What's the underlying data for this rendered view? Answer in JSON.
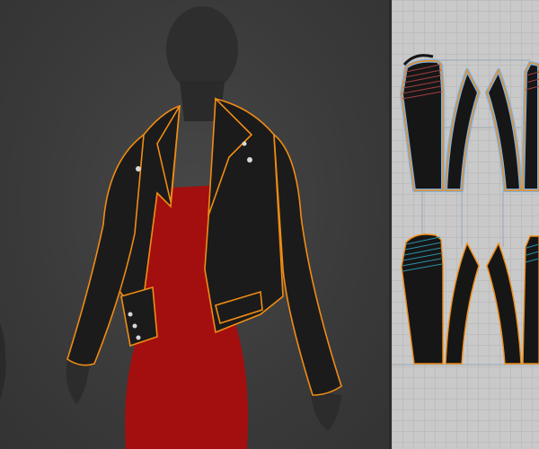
{
  "viewport_3d": {
    "background": "#3a3a3a",
    "avatar_color": "#2c2c2c",
    "dress_color": "#a30f0f",
    "jacket_color": "#1b1b1b",
    "seam_color": "#f08c14"
  },
  "pattern_2d": {
    "background": "#c9c9c9",
    "piece_fill": "#161616",
    "piece_outline": "#f08c14",
    "selected_halo": "#7fb2e6",
    "upper_stitch_color": "#a04040",
    "lower_stitch_color": "#2a8fa8"
  }
}
